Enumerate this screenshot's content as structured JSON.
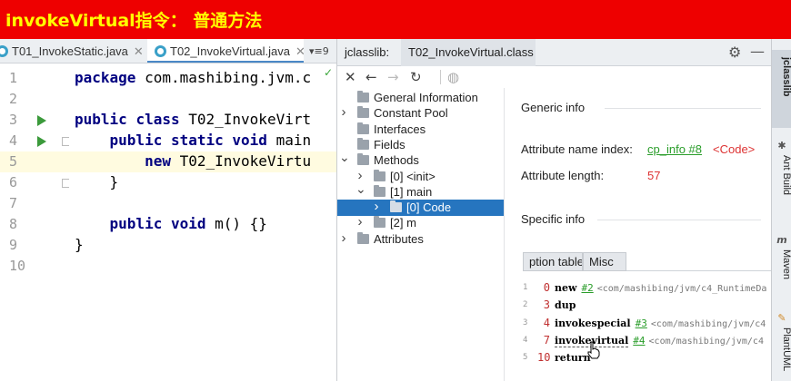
{
  "banner": {
    "title": "invokeVirtual指令：  普通方法"
  },
  "editor": {
    "tabs": [
      {
        "label": "T01_InvokeStatic.java",
        "active": false
      },
      {
        "label": "T02_InvokeVirtual.java",
        "active": true
      }
    ],
    "more_tabs": "9",
    "line_numbers": [
      "1",
      "2",
      "3",
      "4",
      "5",
      "6",
      "7",
      "8",
      "9",
      "10"
    ],
    "lines": [
      "package com.mashibing.jvm.c",
      "",
      "public class T02_InvokeVirt",
      "    public static void main",
      "        new T02_InvokeVirtu",
      "    }",
      "",
      "    public void m() {}",
      "}",
      ""
    ],
    "highlighted_line": 5
  },
  "jclasslib": {
    "title": "jclasslib:",
    "tab": "T02_InvokeVirtual.class",
    "tree": [
      {
        "label": "General Information",
        "depth": 0,
        "arrow": "",
        "selected": false
      },
      {
        "label": "Constant Pool",
        "depth": 0,
        "arrow": ">",
        "selected": false
      },
      {
        "label": "Interfaces",
        "depth": 0,
        "arrow": "",
        "selected": false
      },
      {
        "label": "Fields",
        "depth": 0,
        "arrow": "",
        "selected": false
      },
      {
        "label": "Methods",
        "depth": 0,
        "arrow": "v",
        "selected": false
      },
      {
        "label": "[0] <init>",
        "depth": 1,
        "arrow": ">",
        "selected": false
      },
      {
        "label": "[1] main",
        "depth": 1,
        "arrow": "v",
        "selected": false
      },
      {
        "label": "[0] Code",
        "depth": 2,
        "arrow": ">",
        "selected": true
      },
      {
        "label": "[2] m",
        "depth": 1,
        "arrow": ">",
        "selected": false
      },
      {
        "label": "Attributes",
        "depth": 0,
        "arrow": ">",
        "selected": false
      }
    ],
    "detail": {
      "generic_info": "Generic info",
      "attr_name_label": "Attribute name index:",
      "attr_name_link": "cp_info #8",
      "attr_name_value": "<Code>",
      "attr_length_label": "Attribute length:",
      "attr_length_value": "57",
      "specific_info": "Specific info",
      "sub_tabs": [
        "ption table",
        "Misc"
      ],
      "bytecode": [
        {
          "line": "1",
          "offset": "0",
          "op": "new",
          "ref": "#2",
          "arg": "<com/mashibing/jvm/c4_RuntimeDa"
        },
        {
          "line": "2",
          "offset": "3",
          "op": "dup",
          "ref": "",
          "arg": ""
        },
        {
          "line": "3",
          "offset": "4",
          "op": "invokespecial",
          "ref": "#3",
          "arg": "<com/mashibing/jvm/c4"
        },
        {
          "line": "4",
          "offset": "7",
          "op": "invokevirtual",
          "ref": "#4",
          "arg": "<com/mashibing/jvm/c4"
        },
        {
          "line": "5",
          "offset": "10",
          "op": "return",
          "ref": "",
          "arg": ""
        }
      ]
    }
  },
  "tool_windows": [
    "jclasslib",
    "Ant Build",
    "Maven",
    "PlantUML"
  ],
  "colors": {
    "banner_bg": "#ee0000",
    "banner_text": "#ffff00",
    "keyword": "#000080",
    "link_green": "#2a9d2a",
    "selection": "#2675bf"
  }
}
